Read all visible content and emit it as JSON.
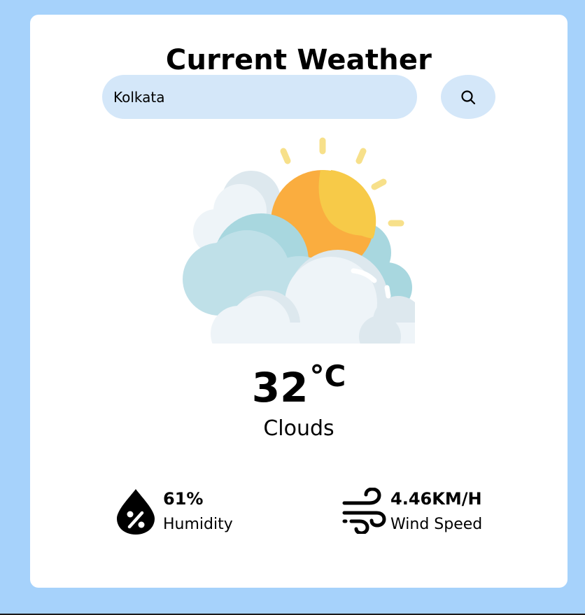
{
  "app": {
    "title": "Current Weather"
  },
  "search": {
    "value": "Kolkata",
    "button_icon": "search-icon"
  },
  "weather": {
    "icon": "sun-behind-clouds-icon",
    "temperature": "32",
    "unit": "°C",
    "condition": "Clouds"
  },
  "details": {
    "humidity": {
      "value": "61%",
      "label": "Humidity",
      "icon": "humidity-drop-icon"
    },
    "wind": {
      "value": "4.46KM/H",
      "label": "Wind Speed",
      "icon": "wind-icon"
    }
  },
  "colors": {
    "page_background": "#a6d2fb",
    "card_background": "#ffffff",
    "input_background": "#d4e7f9",
    "sun_outer": "#faad3f",
    "sun_inner": "#f7ca48",
    "sun_rays": "#f7e08a",
    "cloud_blue": "#a8d7df",
    "cloud_light": "#eff4f7"
  }
}
